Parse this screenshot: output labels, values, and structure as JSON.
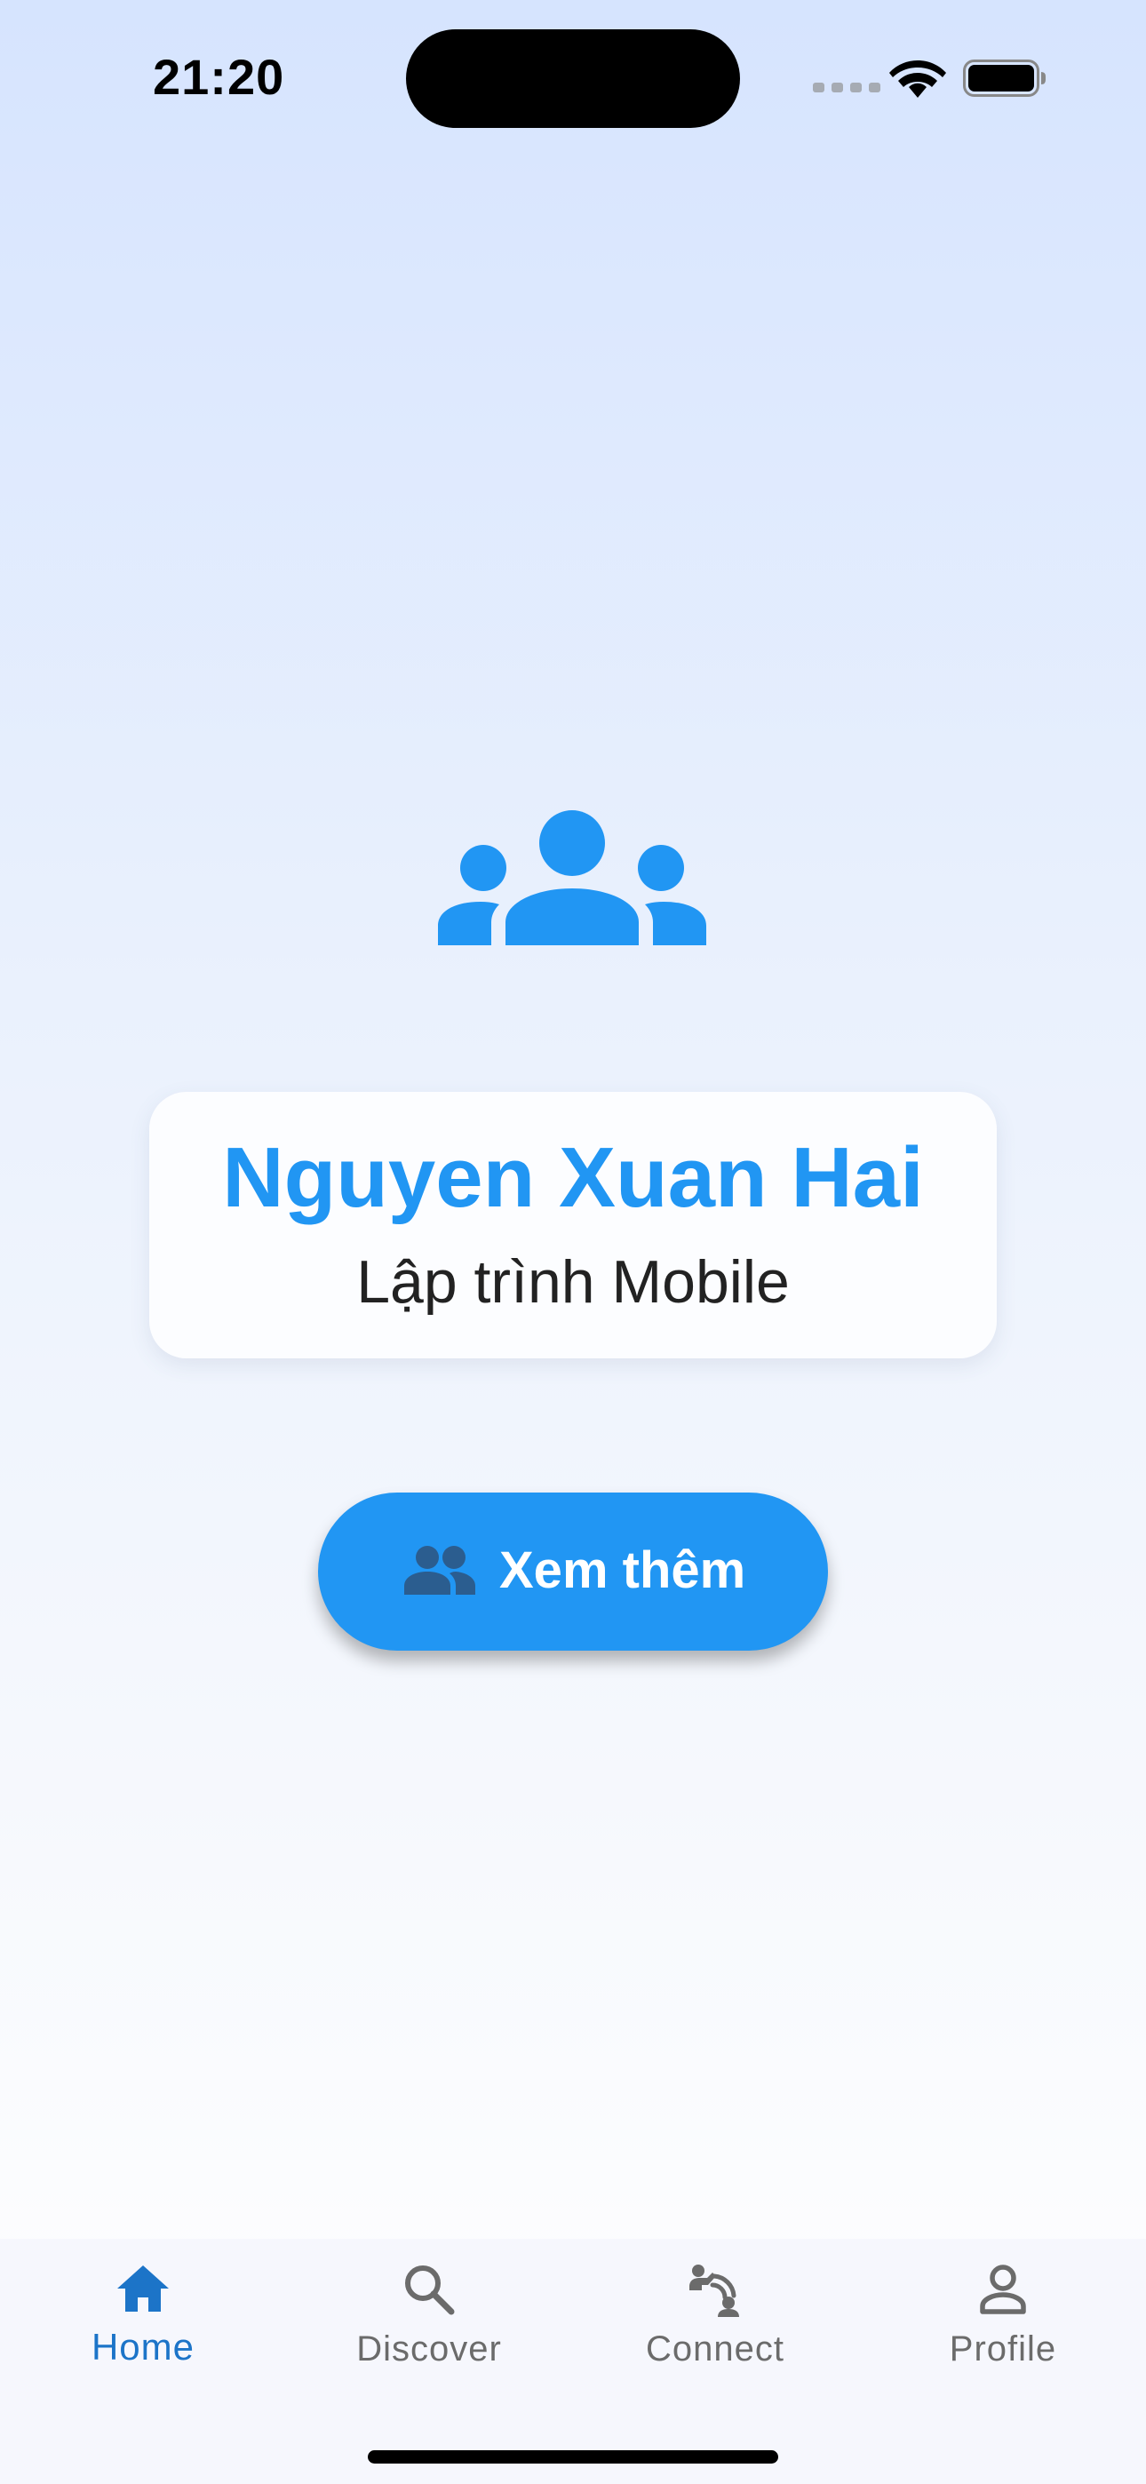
{
  "status_bar": {
    "time": "21:20"
  },
  "profile": {
    "name": "Nguyen Xuan Hai",
    "role": "Lập trình Mobile",
    "icon": "group-icon",
    "accent_color": "#2196f3"
  },
  "action": {
    "see_more_label": "Xem thêm",
    "icon": "group-icon"
  },
  "bottom_nav": {
    "items": [
      {
        "label": "Home",
        "icon": "home-icon",
        "active": true
      },
      {
        "label": "Discover",
        "icon": "search-icon",
        "active": false
      },
      {
        "label": "Connect",
        "icon": "connect-icon",
        "active": false
      },
      {
        "label": "Profile",
        "icon": "person-icon",
        "active": false
      }
    ],
    "active_color": "#1c74c8",
    "inactive_color": "#6b6b6b"
  }
}
